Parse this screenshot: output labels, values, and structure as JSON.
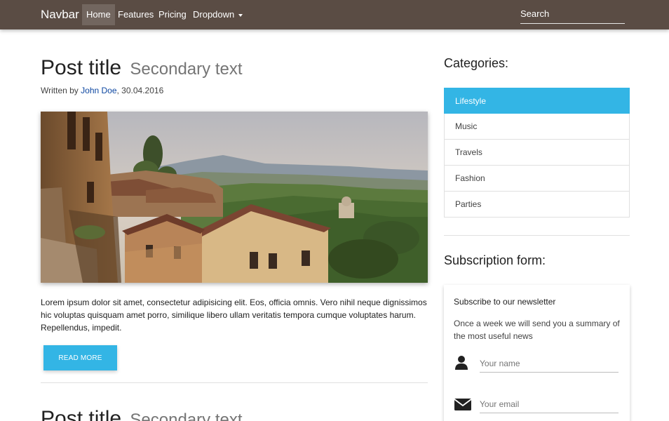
{
  "navbar": {
    "brand": "Navbar",
    "items": [
      {
        "label": "Home"
      },
      {
        "label": "Features"
      },
      {
        "label": "Pricing"
      },
      {
        "label": "Dropdown"
      }
    ],
    "search_placeholder": "Search"
  },
  "post": {
    "title": "Post title",
    "secondary": "Secondary text",
    "byline_prefix": "Written by ",
    "author": "John Doe",
    "date": ", 30.04.2016",
    "excerpt": "Lorem ipsum dolor sit amet, consectetur adipisicing elit. Eos, officia omnis. Vero nihil neque dignissimos hic voluptas quisquam amet porro, similique libero ullam veritatis tempora cumque voluptates harum. Repellendus, impedit.",
    "read_more": "Read more"
  },
  "post2": {
    "title": "Post title",
    "secondary": "Secondary text"
  },
  "sidebar": {
    "categories_heading": "Categories:",
    "categories": [
      {
        "label": "Lifestyle"
      },
      {
        "label": "Music"
      },
      {
        "label": "Travels"
      },
      {
        "label": "Fashion"
      },
      {
        "label": "Parties"
      }
    ],
    "subscription_heading": "Subscription form:",
    "form": {
      "title": "Subscribe to our newsletter",
      "text": "Once a week we will send you a summary of the most useful news",
      "name_placeholder": "Your name",
      "email_placeholder": "Your email"
    }
  },
  "colors": {
    "navbar": "#5a4c44",
    "accent": "#33b5e5",
    "link": "#0d47a1"
  }
}
